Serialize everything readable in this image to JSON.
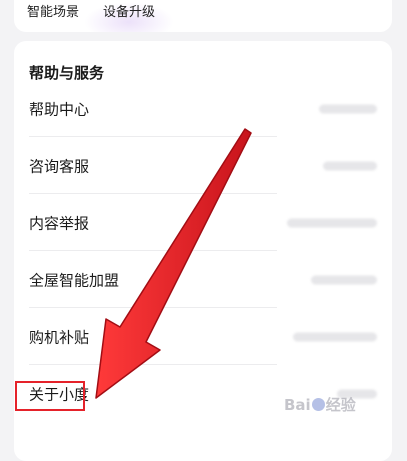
{
  "quick_actions": {
    "smart_scene": "智能场景",
    "device_upgrade": "设备升级"
  },
  "help_section": {
    "title": "帮助与服务",
    "items": [
      {
        "label": "帮助中心"
      },
      {
        "label": "咨询客服"
      },
      {
        "label": "内容举报"
      },
      {
        "label": "全屋智能加盟"
      },
      {
        "label": "购机补贴"
      },
      {
        "label": "关于小度"
      }
    ]
  },
  "annotation": {
    "arrow_color": "#e5222a",
    "highlight_color": "#e5222a"
  },
  "watermark": {
    "prefix": "Bai",
    "suffix": "经验"
  }
}
